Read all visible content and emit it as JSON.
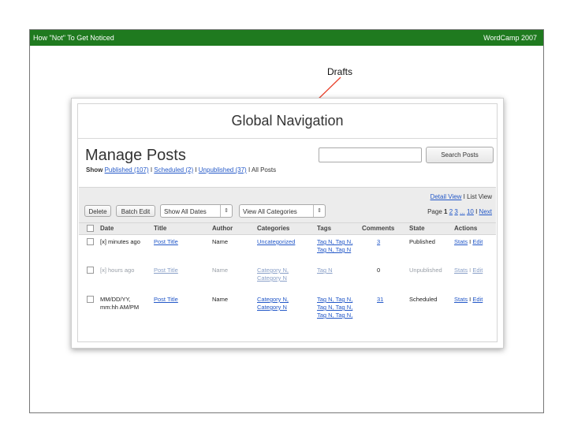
{
  "slide": {
    "header_left": "How \"Not\" To Get Noticed",
    "header_right": "WordCamp 2007",
    "annotation": "Drafts",
    "accent_color": "#1f7a1f"
  },
  "window": {
    "global_nav": "Global Navigation"
  },
  "manage": {
    "title": "Manage Posts",
    "show_label": "Show",
    "filters": [
      "Published (107)",
      "Scheduled (2)",
      "Unpublished (37)",
      "All Posts"
    ],
    "search_button": "Search Posts",
    "search_placeholder": ""
  },
  "toolbar": {
    "delete": "Delete",
    "batch_edit": "Batch Edit",
    "dates_select": "Show All Dates",
    "categories_select": "View All Categories",
    "detail_view": "Detail View",
    "list_view": "List View",
    "page_label": "Page",
    "pages": [
      "1",
      "2",
      "3",
      "...",
      "10",
      "Next"
    ]
  },
  "table": {
    "columns": [
      "Date",
      "Title",
      "Author",
      "Categories",
      "Tags",
      "Comments",
      "State",
      "Actions"
    ],
    "rows": [
      {
        "date": "[x] minutes ago",
        "date2": "",
        "title": "Post Title",
        "author": "Name",
        "cat1": "Uncategorized",
        "cat2": "",
        "tags": [
          "Tag N, Tag N,",
          "Tag N, Tag N"
        ],
        "comments": "3",
        "state": "Published",
        "stats": "Stats",
        "edit": "Edit"
      },
      {
        "date": "[x] hours ago",
        "date2": "",
        "title": "Post Title",
        "author": "Name",
        "cat1": "Category N,",
        "cat2": "Category N",
        "tags": [
          "Tag N"
        ],
        "comments": "0",
        "state": "Unpublished",
        "stats": "Stats",
        "edit": "Edit"
      },
      {
        "date": "MM/DD/YY,",
        "date2": "mm:hh AM/PM",
        "title": "Post Title",
        "author": "Name",
        "cat1": "Category N,",
        "cat2": "Category N",
        "tags": [
          "Tag N, Tag N,",
          "Tag N, Tag N,",
          "Tag N, Tag N,"
        ],
        "comments": "31",
        "state": "Scheduled",
        "stats": "Stats",
        "edit": "Edit"
      }
    ]
  }
}
